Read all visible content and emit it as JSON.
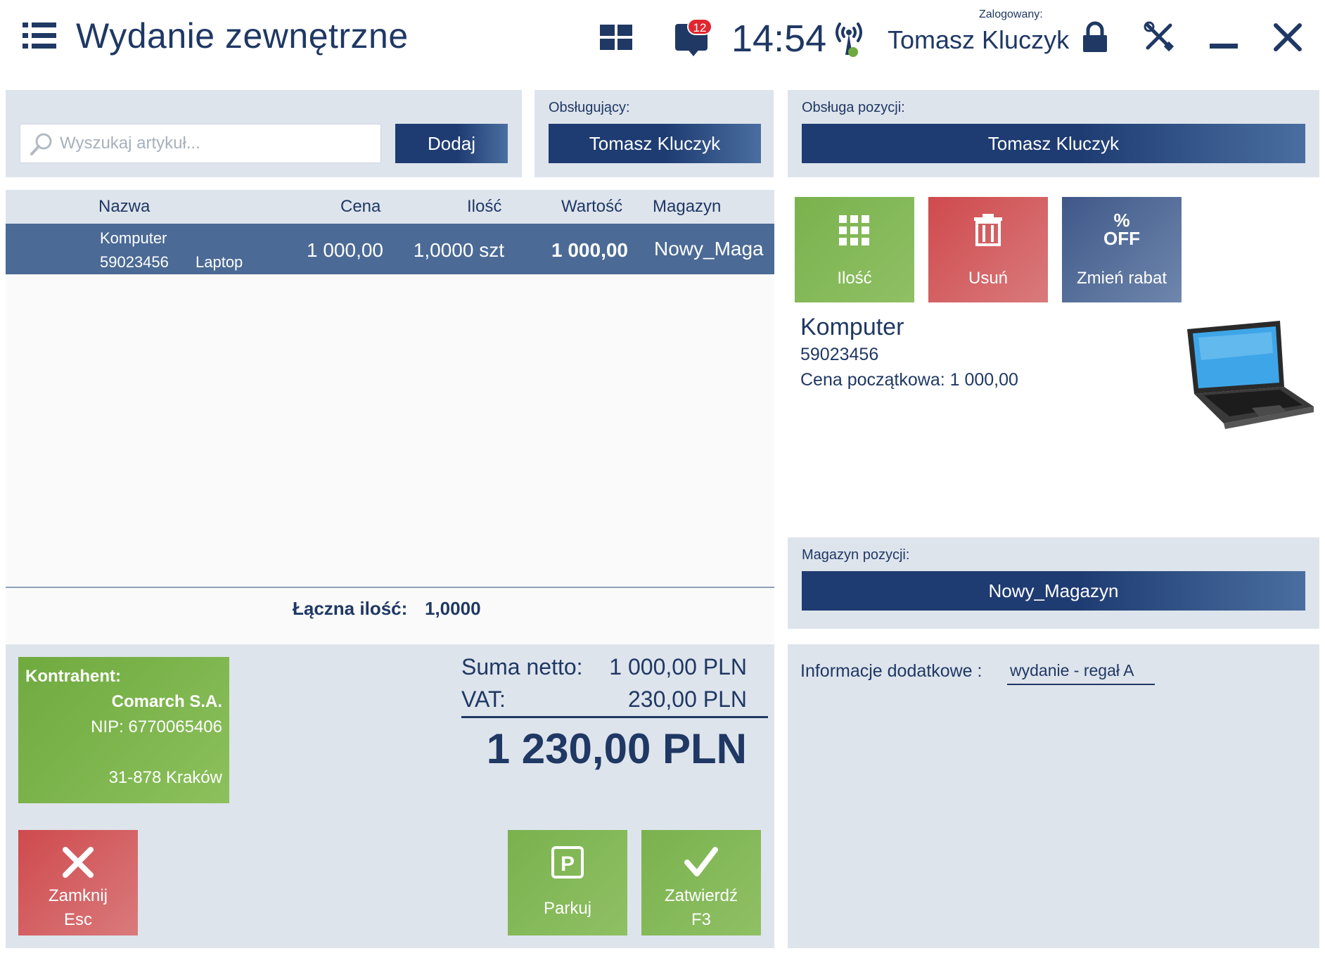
{
  "header": {
    "title": "Wydanie zewnętrzne",
    "notification_count": "12",
    "time": "14:54",
    "logged_in_label": "Zalogowany:",
    "user_name": "Tomasz Kluczyk"
  },
  "search": {
    "placeholder": "Wyszukaj artykuł...",
    "add_label": "Dodaj"
  },
  "attendant": {
    "label": "Obsługujący:",
    "value": "Tomasz Kluczyk"
  },
  "item_handling": {
    "label": "Obsługa pozycji:",
    "value": "Tomasz Kluczyk"
  },
  "table": {
    "columns": [
      "Nazwa",
      "Cena",
      "Ilość",
      "Wartość",
      "Magazyn"
    ],
    "rows": [
      {
        "name": "Komputer",
        "code": "59023456",
        "category": "Laptop",
        "price": "1 000,00",
        "quantity": "1,0000 szt",
        "value": "1 000,00",
        "warehouse": "Nowy_Maga"
      }
    ],
    "total_quantity_label": "Łączna ilość:",
    "total_quantity_value": "1,0000"
  },
  "item_actions": {
    "quantity_label": "Ilość",
    "delete_label": "Usuń",
    "discount_icon_text": "%",
    "discount_icon_off": "OFF",
    "discount_label": "Zmień rabat"
  },
  "product": {
    "name": "Komputer",
    "code": "59023456",
    "start_price": "Cena początkowa: 1 000,00",
    "image_icon": "laptop-image"
  },
  "item_warehouse": {
    "label": "Magazyn pozycji:",
    "value": "Nowy_Magazyn"
  },
  "contractor": {
    "label": "Kontrahent:",
    "name": "Comarch S.A.",
    "nip": "NIP: 6770065406",
    "address": "31-878  Kraków"
  },
  "totals": {
    "net_label": "Suma netto:",
    "net_value": "1 000,00 PLN",
    "vat_label": "VAT:",
    "vat_value": "230,00 PLN",
    "grand_total": "1 230,00 PLN"
  },
  "actions": {
    "close_label": "Zamknij",
    "close_key": "Esc",
    "park_label": "Parkuj",
    "confirm_label": "Zatwierdź",
    "confirm_key": "F3"
  },
  "additional_info": {
    "label": "Informacje dodatkowe :",
    "value": "wydanie - regał A"
  },
  "colors": {
    "primary": "#1f3864",
    "green": "#7ab24e",
    "red": "#cf4a4d",
    "panel": "#dee4ec",
    "selected_row": "#4b6a95"
  }
}
